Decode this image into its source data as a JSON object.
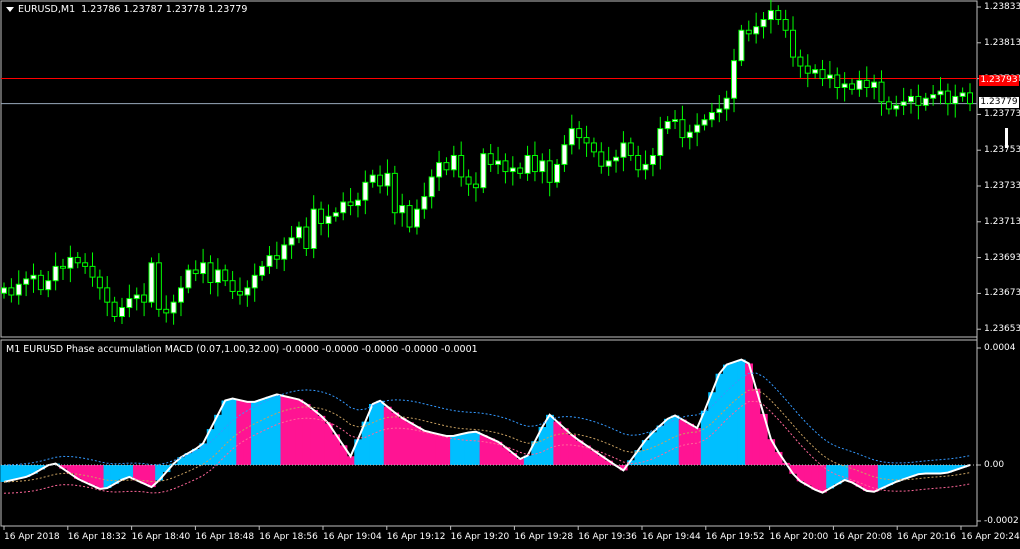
{
  "header": {
    "symbol": "EURUSD,M1",
    "ohlc": "1.23786 1.23787 1.23778 1.23779"
  },
  "price_axis": {
    "ticks": [
      "1.23833",
      "1.23813",
      "1.23793",
      "1.23773",
      "1.23753",
      "1.23733",
      "1.23713",
      "1.23693",
      "1.23673",
      "1.23653"
    ],
    "current_price": "1.23779",
    "red_line_price": "1.23793",
    "current_color": "#ffffff",
    "red_color": "#ff0000"
  },
  "indicator": {
    "title": "M1 EURUSD Phase accumulation MACD (0.07,1.00,32.00) -0.0000 -0.0000 -0.0000 -0.0000 -0.0001",
    "ticks": [
      "0.0004",
      "0.00",
      "-0.0002"
    ]
  },
  "time_axis": {
    "labels": [
      "16 Apr 2018",
      "16 Apr 18:32",
      "16 Apr 18:40",
      "16 Apr 18:48",
      "16 Apr 18:56",
      "16 Apr 19:04",
      "16 Apr 19:12",
      "16 Apr 19:20",
      "16 Apr 19:28",
      "16 Apr 19:36",
      "16 Apr 19:44",
      "16 Apr 19:52",
      "16 Apr 20:00",
      "16 Apr 20:08",
      "16 Apr 20:16",
      "16 Apr 20:24"
    ]
  },
  "colors": {
    "bull_candle": "#ffffff",
    "bear_candle": "#000000",
    "wick": "#00ff00",
    "hist_up": "#00bfff",
    "hist_down": "#ff1493",
    "macd_line": "#ffffff",
    "grid": "#c0c0c0"
  },
  "chart_data": [
    {
      "type": "candlestick",
      "series_closes": [
        1.23676,
        1.23672,
        1.23678,
        1.23681,
        1.23683,
        1.23675,
        1.2368,
        1.23688,
        1.23687,
        1.23693,
        1.2369,
        1.23688,
        1.23682,
        1.23676,
        1.23668,
        1.2366,
        1.23665,
        1.2367,
        1.23672,
        1.23668,
        1.2369,
        1.23664,
        1.23662,
        1.23668,
        1.23676,
        1.23686,
        1.23684,
        1.2369,
        1.23679,
        1.23686,
        1.2368,
        1.23674,
        1.23672,
        1.23676,
        1.23683,
        1.23688,
        1.23694,
        1.23692,
        1.237,
        1.23704,
        1.2371,
        1.23698,
        1.2372,
        1.23712,
        1.23716,
        1.23718,
        1.23724,
        1.23722,
        1.23725,
        1.23735,
        1.23739,
        1.23733,
        1.2374,
        1.23718,
        1.23722,
        1.2371,
        1.2372,
        1.23727,
        1.23738,
        1.23746,
        1.23742,
        1.2375,
        1.23738,
        1.23734,
        1.23732,
        1.23751,
        1.23745,
        1.23747,
        1.23741,
        1.23743,
        1.2374,
        1.2375,
        1.23741,
        1.23747,
        1.23735,
        1.23745,
        1.23756,
        1.23765,
        1.2376,
        1.23757,
        1.23752,
        1.23744,
        1.23747,
        1.23749,
        1.23757,
        1.2375,
        1.23742,
        1.23745,
        1.2375,
        1.23765,
        1.23769,
        1.2377,
        1.2376,
        1.23763,
        1.23767,
        1.2377,
        1.23774,
        1.23776,
        1.23782,
        1.23803,
        1.2382,
        1.23818,
        1.23822,
        1.23826,
        1.23831,
        1.23826,
        1.2382,
        1.23805,
        1.238,
        1.23796,
        1.23798,
        1.23793,
        1.23795,
        1.23788,
        1.2379,
        1.23787,
        1.23792,
        1.23788,
        1.23791,
        1.2378,
        1.23776,
        1.23778,
        1.2378,
        1.23783,
        1.23778,
        1.23782,
        1.23784,
        1.23786,
        1.23779,
        1.23783,
        1.23785,
        1.23779
      ],
      "ylim": [
        1.23645,
        1.2384
      ]
    },
    {
      "type": "bar",
      "name": "Phase accumulation MACD",
      "ylim": [
        -0.0002,
        0.0004
      ],
      "values_sample": [
        -6e-05,
        -4e-05,
        1e-05,
        -5e-05,
        -9e-05,
        -4e-05,
        -8e-05,
        2e-05,
        7e-05,
        0.00024,
        0.00022,
        0.00025,
        0.00023,
        0.00016,
        3e-05,
        0.00024,
        0.00017,
        0.00012,
        0.0001,
        0.00012,
        8e-05,
        1e-05,
        0.00018,
        0.0001,
        4e-05,
        -2e-05,
        0.0001,
        0.00018,
        0.00013,
        0.00035,
        0.00038,
        8e-05,
        -5e-05,
        -0.0001,
        -5e-05,
        -0.0001,
        -6e-05,
        -3e-05,
        -3e-05,
        0.0
      ]
    }
  ]
}
